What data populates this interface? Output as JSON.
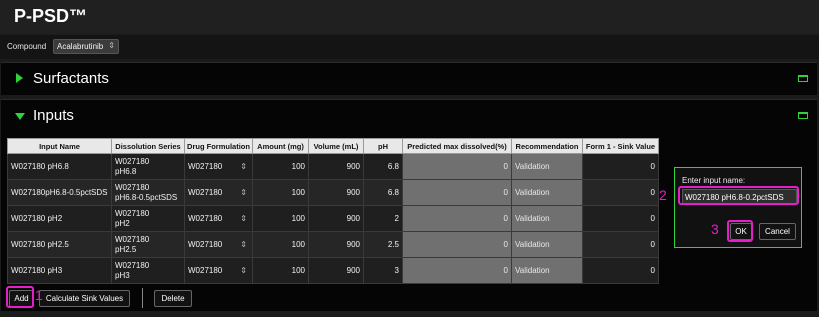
{
  "app": {
    "title": "P-PSD™"
  },
  "compound": {
    "label": "Compound",
    "value": "Acalabrutinib"
  },
  "sections": {
    "surfactants": "Surfactants",
    "inputs": "Inputs"
  },
  "table": {
    "headers": [
      "Input Name",
      "Dissolution Series",
      "Drug Formulation",
      "Amount (mg)",
      "Volume (mL)",
      "pH",
      "Predicted max dissolved(%)",
      "Recommendation",
      "Form 1 - Sink Value"
    ],
    "rows": [
      {
        "name": "W027180 pH6.8",
        "series": [
          "W027180",
          "pH6.8"
        ],
        "formulation": "W027180",
        "amount": "100",
        "volume": "900",
        "ph": "6.8",
        "predicted": "0",
        "recommendation": "Validation",
        "sink": "0"
      },
      {
        "name": "W027180pH6.8-0.5pctSDS",
        "series": [
          "W027180",
          "pH6.8-0.5pctSDS"
        ],
        "formulation": "W027180",
        "amount": "100",
        "volume": "900",
        "ph": "6.8",
        "predicted": "0",
        "recommendation": "Validation",
        "sink": "0"
      },
      {
        "name": "W027180 pH2",
        "series": [
          "W027180",
          "pH2"
        ],
        "formulation": "W027180",
        "amount": "100",
        "volume": "900",
        "ph": "2",
        "predicted": "0",
        "recommendation": "Validation",
        "sink": "0"
      },
      {
        "name": "W027180 pH2.5",
        "series": [
          "W027180",
          "pH2.5"
        ],
        "formulation": "W027180",
        "amount": "100",
        "volume": "900",
        "ph": "2.5",
        "predicted": "0",
        "recommendation": "Validation",
        "sink": "0"
      },
      {
        "name": "W027180 pH3",
        "series": [
          "W027180",
          "pH3"
        ],
        "formulation": "W027180",
        "amount": "100",
        "volume": "900",
        "ph": "3",
        "predicted": "0",
        "recommendation": "Validation",
        "sink": "0"
      }
    ]
  },
  "buttons": {
    "add": "Add",
    "calculate": "Calculate Sink Values",
    "delete": "Delete"
  },
  "dialog": {
    "label": "Enter input name:",
    "value": "W027180 pH6.8-0.2pctSDS",
    "ok": "OK",
    "cancel": "Cancel"
  },
  "steps": {
    "one": "1",
    "two": "2",
    "three": "3"
  },
  "colors": {
    "accent": "#2fd13c",
    "highlight": "#e61ec9"
  }
}
